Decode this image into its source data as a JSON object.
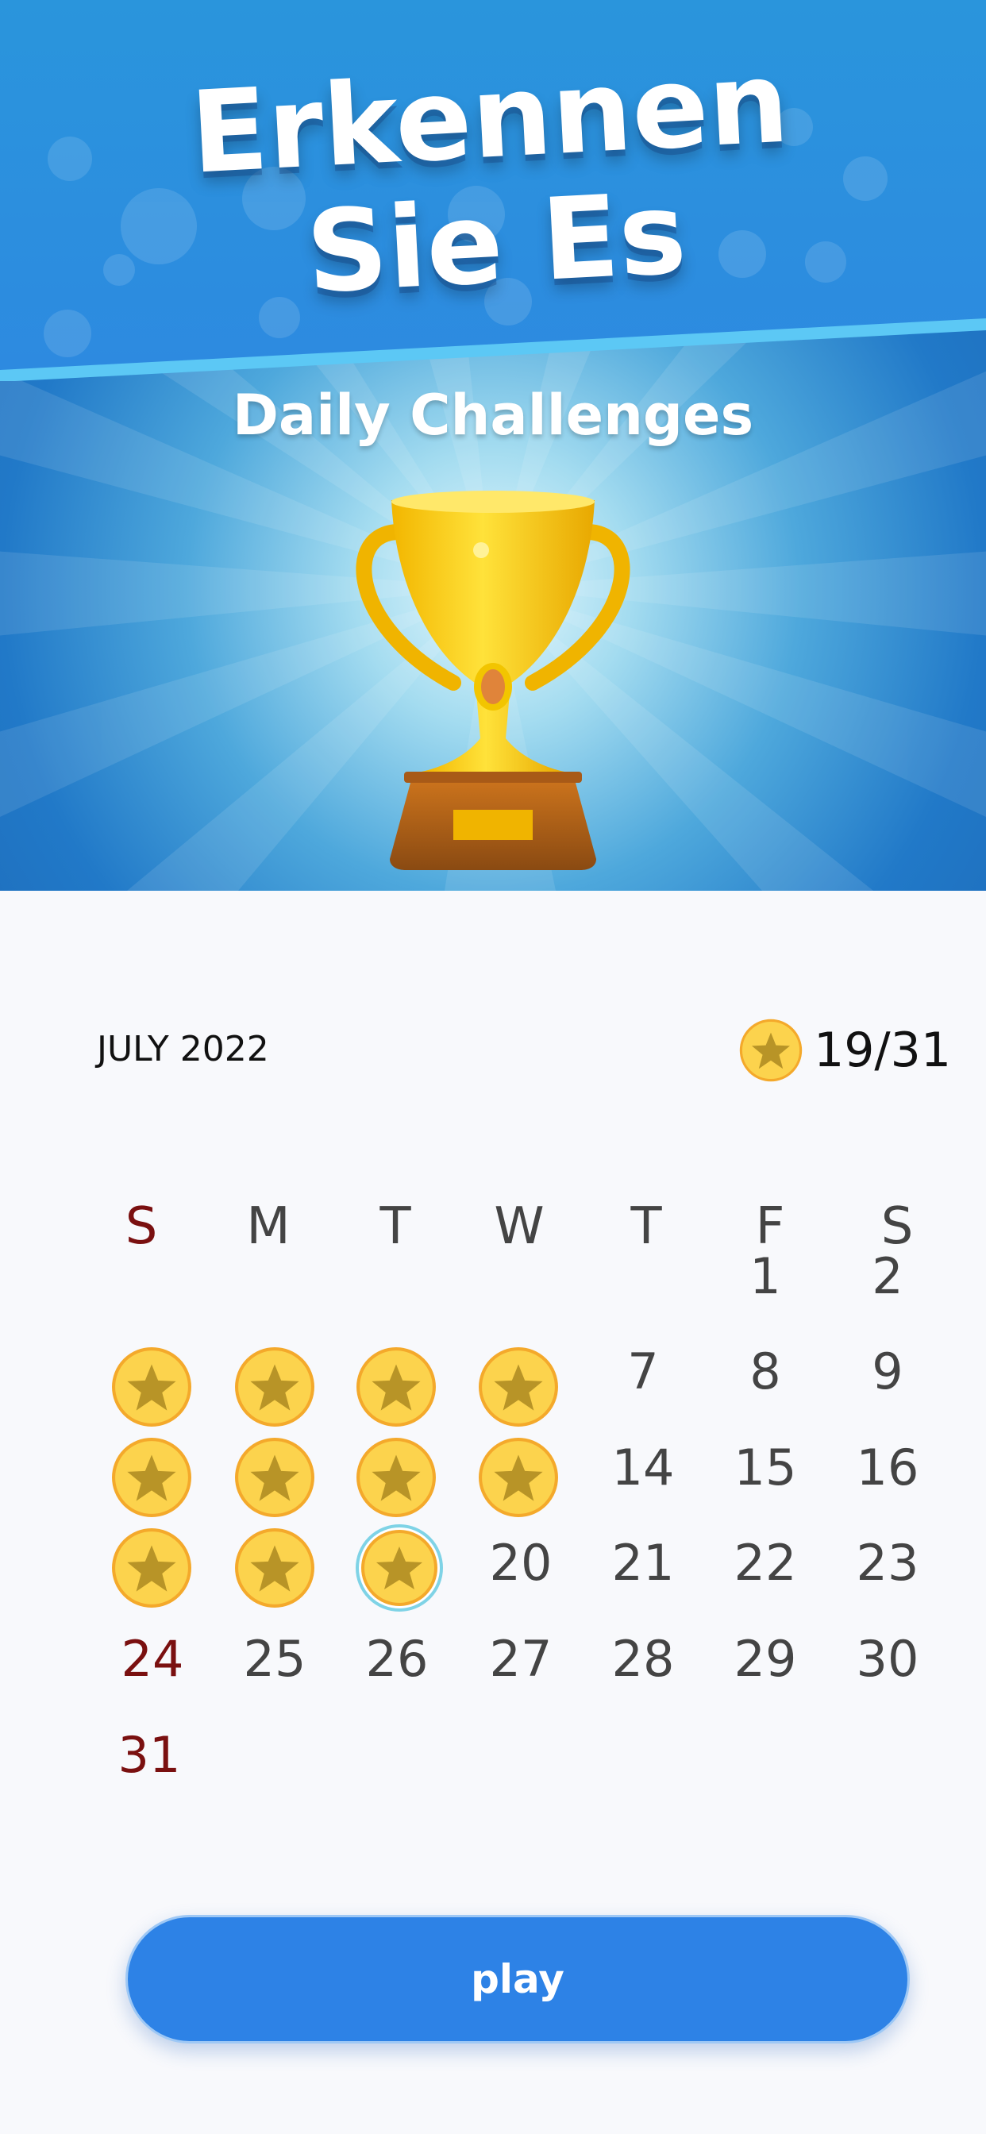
{
  "header": {
    "title_line1": "Erkennen",
    "title_line2": "Sie Es",
    "subtitle": "Daily Challenges"
  },
  "colors": {
    "banner_blue": "#2179c8",
    "coin_gold": "#fcd34d",
    "coin_star": "#b89427",
    "weekend_red": "#7a1010",
    "play_button": "#2d82e6"
  },
  "calendar": {
    "month_label": "JULY 2022",
    "progress": "19/31",
    "progress_icon": "star-coin-icon",
    "weekdays": [
      "S",
      "M",
      "T",
      "W",
      "T",
      "F",
      "S"
    ],
    "days": {
      "d1": "1",
      "d2": "2",
      "d7": "7",
      "d8": "8",
      "d9": "9",
      "d14": "14",
      "d15": "15",
      "d16": "16",
      "d20": "20",
      "d21": "21",
      "d22": "22",
      "d23": "23",
      "d24": "24",
      "d25": "25",
      "d26": "26",
      "d27": "27",
      "d28": "28",
      "d29": "29",
      "d30": "30",
      "d31": "31"
    },
    "completed_days": [
      3,
      4,
      5,
      6,
      10,
      11,
      12,
      13,
      17,
      18,
      19
    ],
    "today": 19
  },
  "play": {
    "label": "play"
  }
}
